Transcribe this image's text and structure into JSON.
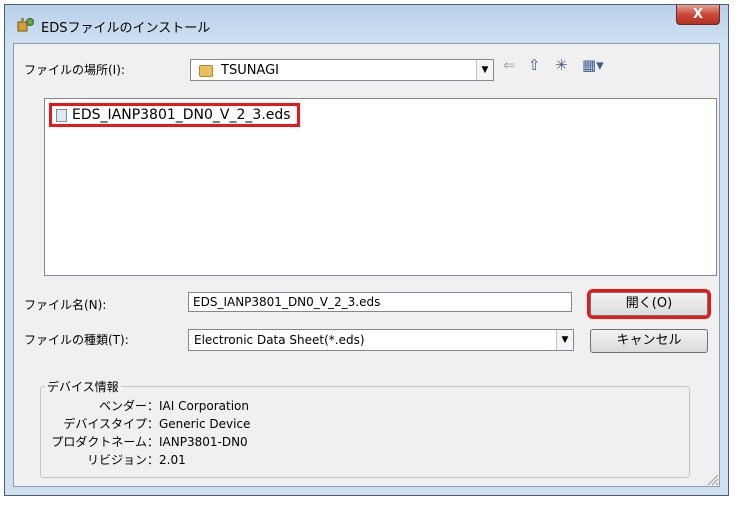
{
  "window": {
    "title": "EDSファイルのインストール",
    "close_label": "X"
  },
  "lookin": {
    "label": "ファイルの場所(I):",
    "value": "TSUNAGI"
  },
  "toolbar": {
    "back_icon": "back-arrow-icon",
    "up_icon": "up-folder-icon",
    "new_icon": "new-folder-icon",
    "view_icon": "view-menu-icon"
  },
  "files": [
    {
      "name": "EDS_IANP3801_DN0_V_2_3.eds"
    }
  ],
  "filename": {
    "label": "ファイル名(N):",
    "value": "EDS_IANP3801_DN0_V_2_3.eds"
  },
  "filetype": {
    "label": "ファイルの種類(T):",
    "value": "Electronic Data Sheet(*.eds)"
  },
  "buttons": {
    "open": "開く(O)",
    "cancel": "キャンセル"
  },
  "device_info": {
    "title": "デバイス情報",
    "rows": [
      {
        "key": "ベンダー：",
        "value": "IAI Corporation"
      },
      {
        "key": "デバイスタイプ：",
        "value": "Generic Device"
      },
      {
        "key": "プロダクトネーム：",
        "value": "IANP3801-DN0"
      },
      {
        "key": "リビジョン：",
        "value": "2.01"
      }
    ]
  },
  "colors": {
    "highlight": "#e8181a",
    "titlebar": "#b9d1ea",
    "close_button": "#c9483a"
  }
}
